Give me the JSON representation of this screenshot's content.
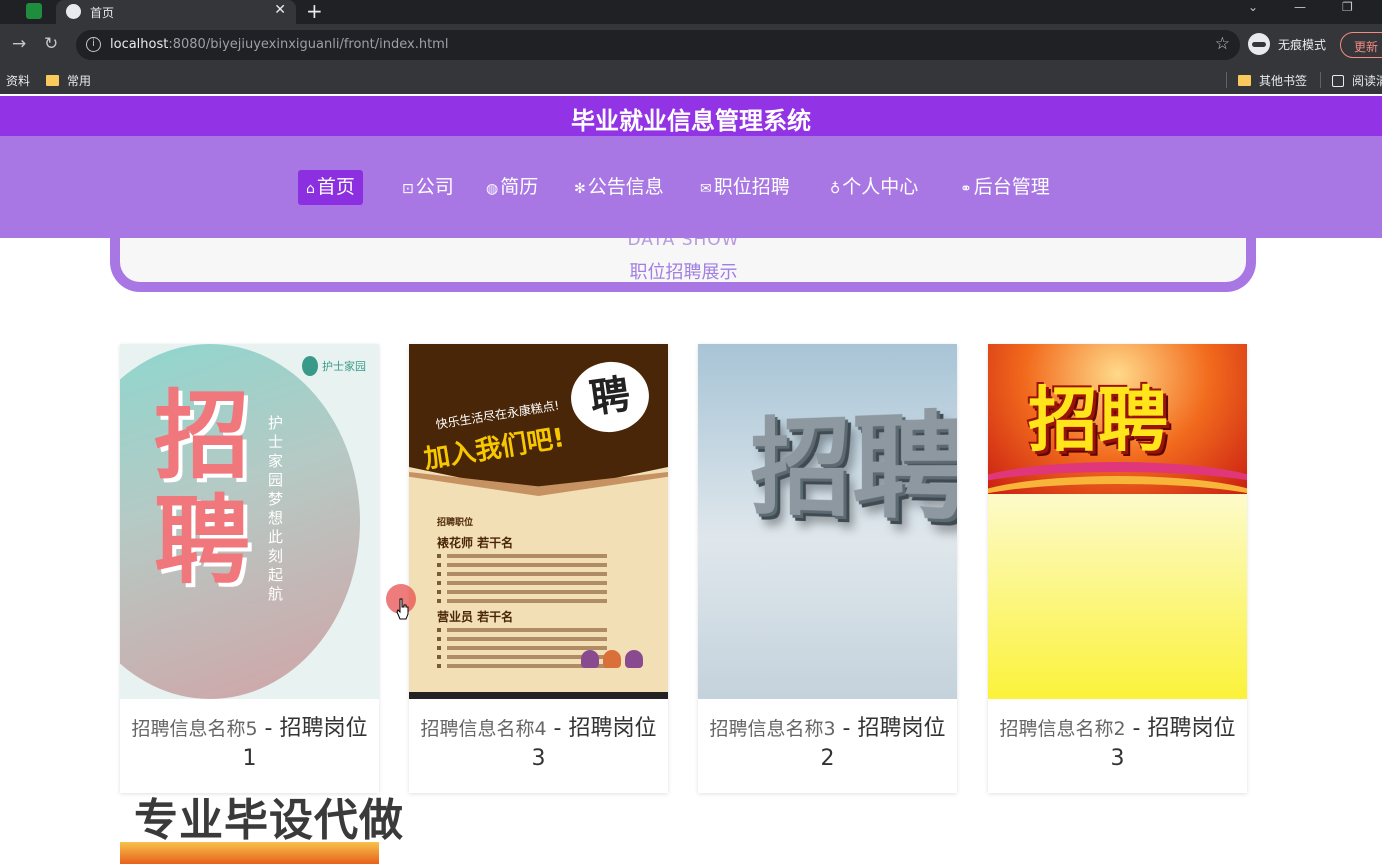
{
  "browser": {
    "tab_title": "首页",
    "url_host": "localhost",
    "url_rest": ":8080/biyejiuyexinxiguanli/front/index.html",
    "incognito_label": "无痕模式",
    "update_label": "更新",
    "bookmarks": [
      "资料",
      "常用"
    ],
    "bookmarks_right": [
      "其他书签",
      "阅读清"
    ]
  },
  "site": {
    "title": "毕业就业信息管理系统",
    "nav": [
      {
        "icon": "⌂",
        "label": "首页",
        "active": true
      },
      {
        "icon": "⊡",
        "label": "公司"
      },
      {
        "icon": "◍",
        "label": "简历"
      },
      {
        "icon": "✻",
        "label": "公告信息"
      },
      {
        "icon": "✉",
        "label": "职位招聘"
      },
      {
        "icon": "♁",
        "label": "个人中心"
      },
      {
        "icon": "⚭",
        "label": "后台管理"
      }
    ]
  },
  "section": {
    "en": "DATA SHOW",
    "zh": "职位招聘展示"
  },
  "cards": [
    {
      "name": "招聘信息名称5",
      "sep": " - ",
      "title": "招聘岗位1",
      "poster": {
        "big": "招聘",
        "vertical": "护士家园 梦想此刻起航",
        "logo": "护士家园"
      }
    },
    {
      "name": "招聘信息名称4",
      "sep": " - ",
      "title": "招聘岗位3",
      "poster": {
        "bubble": "聘",
        "small": "快乐生活尽在永康糕点!",
        "slogan": "加入我们吧!",
        "heading": "招聘职位",
        "job1": "裱花师 若干名",
        "job2": "营业员 若干名"
      }
    },
    {
      "name": "招聘信息名称3",
      "sep": " - ",
      "title": "招聘岗位2",
      "poster": {
        "big": "招聘"
      }
    },
    {
      "name": "招聘信息名称2",
      "sep": " - ",
      "title": "招聘岗位3",
      "poster": {
        "big": "招聘"
      }
    }
  ],
  "overlay": {
    "watermark": "专业毕设代做"
  },
  "colors": {
    "header": "#9333e6",
    "nav": "#a877e4",
    "nav_active": "#8b2fe0"
  }
}
